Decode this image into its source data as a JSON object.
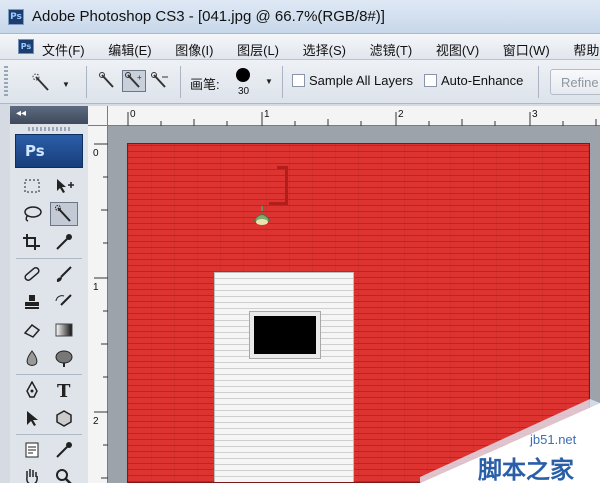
{
  "window": {
    "app_logo": "Ps",
    "title": "Adobe Photoshop CS3 - [041.jpg @ 66.7%(RGB/8#)]"
  },
  "menubar": {
    "logo": "Ps",
    "items": [
      "文件(F)",
      "编辑(E)",
      "图像(I)",
      "图层(L)",
      "选择(S)",
      "滤镜(T)",
      "视图(V)",
      "窗口(W)",
      "帮助"
    ]
  },
  "options_bar": {
    "brush_label": "画笔:",
    "brush_size": "30",
    "sample_all_layers": {
      "label": "Sample All Layers",
      "checked": false
    },
    "auto_enhance": {
      "label": "Auto-Enhance",
      "checked": false
    },
    "refine_label": "Refine"
  },
  "tool_panel": {
    "badge": "Ps",
    "tools": [
      "marquee-icon",
      "move-icon",
      "lasso-icon",
      "quick-selection-icon",
      "crop-icon",
      "eyedropper-icon",
      "healing-brush-icon",
      "brush-icon",
      "clone-stamp-icon",
      "history-brush-icon",
      "eraser-icon",
      "gradient-icon",
      "blur-icon",
      "dodge-icon",
      "pen-icon",
      "type-icon",
      "path-selection-icon",
      "shape-icon",
      "notes-icon",
      "eyedropper-2-icon",
      "hand-icon",
      "zoom-icon"
    ],
    "active_tool": "quick-selection-icon"
  },
  "rulers": {
    "top": [
      "0",
      "1",
      "2",
      "3"
    ],
    "left": [
      "0",
      "1",
      "2"
    ]
  },
  "document": {
    "wall_color": "#de3431",
    "door_color": "#f5f5f5"
  },
  "watermark": {
    "site": "jb51.net",
    "text": "脚本之家"
  }
}
